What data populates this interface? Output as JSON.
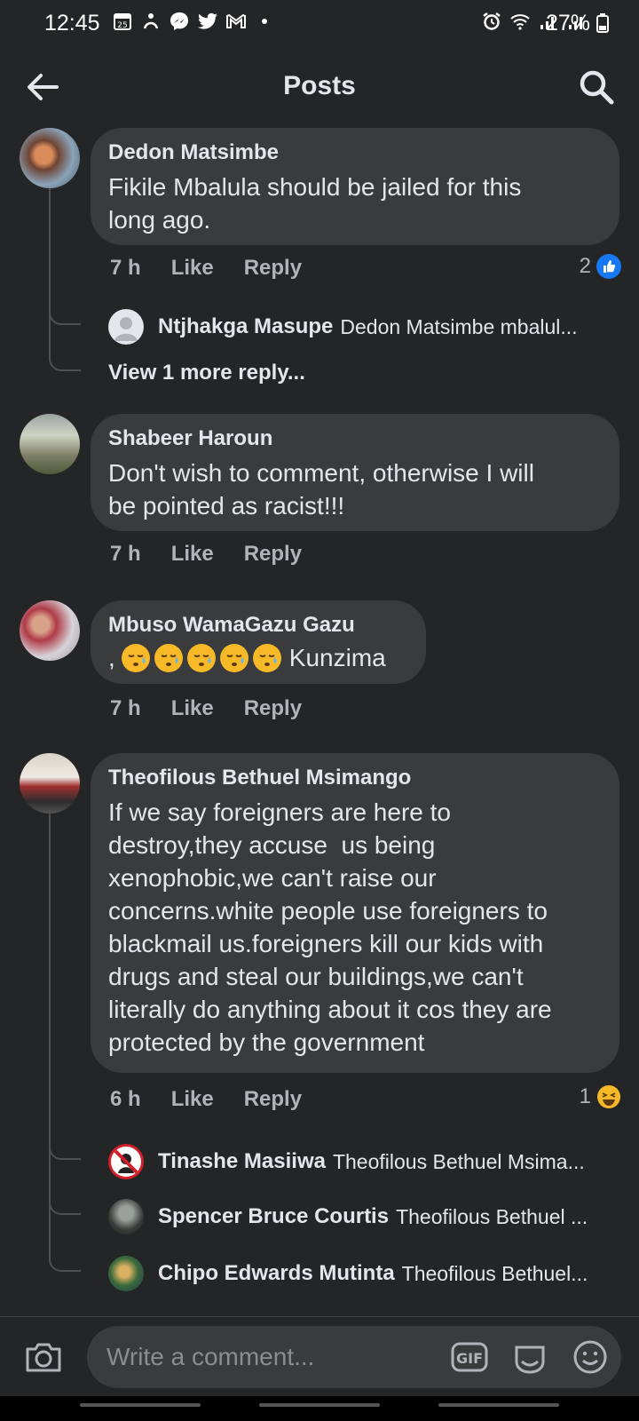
{
  "status_bar": {
    "time": "12:45",
    "battery": "27%",
    "left_icons": [
      "calendar-icon",
      "gesture-icon",
      "messenger-icon",
      "twitter-icon",
      "gmail-icon",
      "dot-icon"
    ],
    "right_icons": [
      "alarm-icon",
      "wifi-icon",
      "signal-icon",
      "signal-icon",
      "battery-icon"
    ]
  },
  "header": {
    "title": "Posts"
  },
  "comments": [
    {
      "author": "Dedon Matsimbe",
      "text_lines": [
        "Fikile Mbalula should be jailed for this",
        "long ago."
      ],
      "time": "7 h",
      "like": "Like",
      "reply": "Reply",
      "reaction_count": "2",
      "reaction": "like",
      "replies": [
        {
          "author": "Ntjhakga Masupe",
          "preview": "Dedon Matsimbe mbalul..."
        }
      ],
      "view_more": "View 1 more reply..."
    },
    {
      "author": "Shabeer Haroun",
      "text_lines": [
        "Don't wish to comment, otherwise I will",
        "be pointed as racist!!!"
      ],
      "time": "7 h",
      "like": "Like",
      "reply": "Reply"
    },
    {
      "author": "Mbuso WamaGazu Gazu",
      "text_prefix": ",",
      "emojis": [
        "sleepy-face",
        "sleepy-face",
        "sleepy-face",
        "sleepy-face",
        "sleepy-face"
      ],
      "text_suffix": "Kunzima",
      "time": "7 h",
      "like": "Like",
      "reply": "Reply"
    },
    {
      "author": "Theofilous Bethuel Msimango",
      "text_lines": [
        "If we say foreigners are here to",
        "destroy,they accuse  us being",
        "xenophobic,we can't raise our",
        "concerns.white people use foreigners to",
        "blackmail us.foreigners kill our kids with",
        "drugs and steal our buildings,we can't",
        "literally do anything about it cos they are",
        "protected by the government"
      ],
      "time": "6 h",
      "like": "Like",
      "reply": "Reply",
      "reaction_count": "1",
      "reaction": "haha",
      "replies": [
        {
          "author": "Tinashe Masiiwa",
          "preview": "Theofilous Bethuel Msima..."
        },
        {
          "author": "Spencer Bruce Courtis",
          "preview": "Theofilous Bethuel ..."
        },
        {
          "author": "Chipo Edwards Mutinta",
          "preview": "Theofilous Bethuel..."
        }
      ]
    }
  ],
  "composer": {
    "placeholder": "Write a comment...",
    "gif_label": "GIF"
  },
  "colors": {
    "background": "#242526",
    "bubble": "#3a3b3c",
    "like_blue": "#1877f2",
    "haha_yellow": "#f7b928"
  }
}
